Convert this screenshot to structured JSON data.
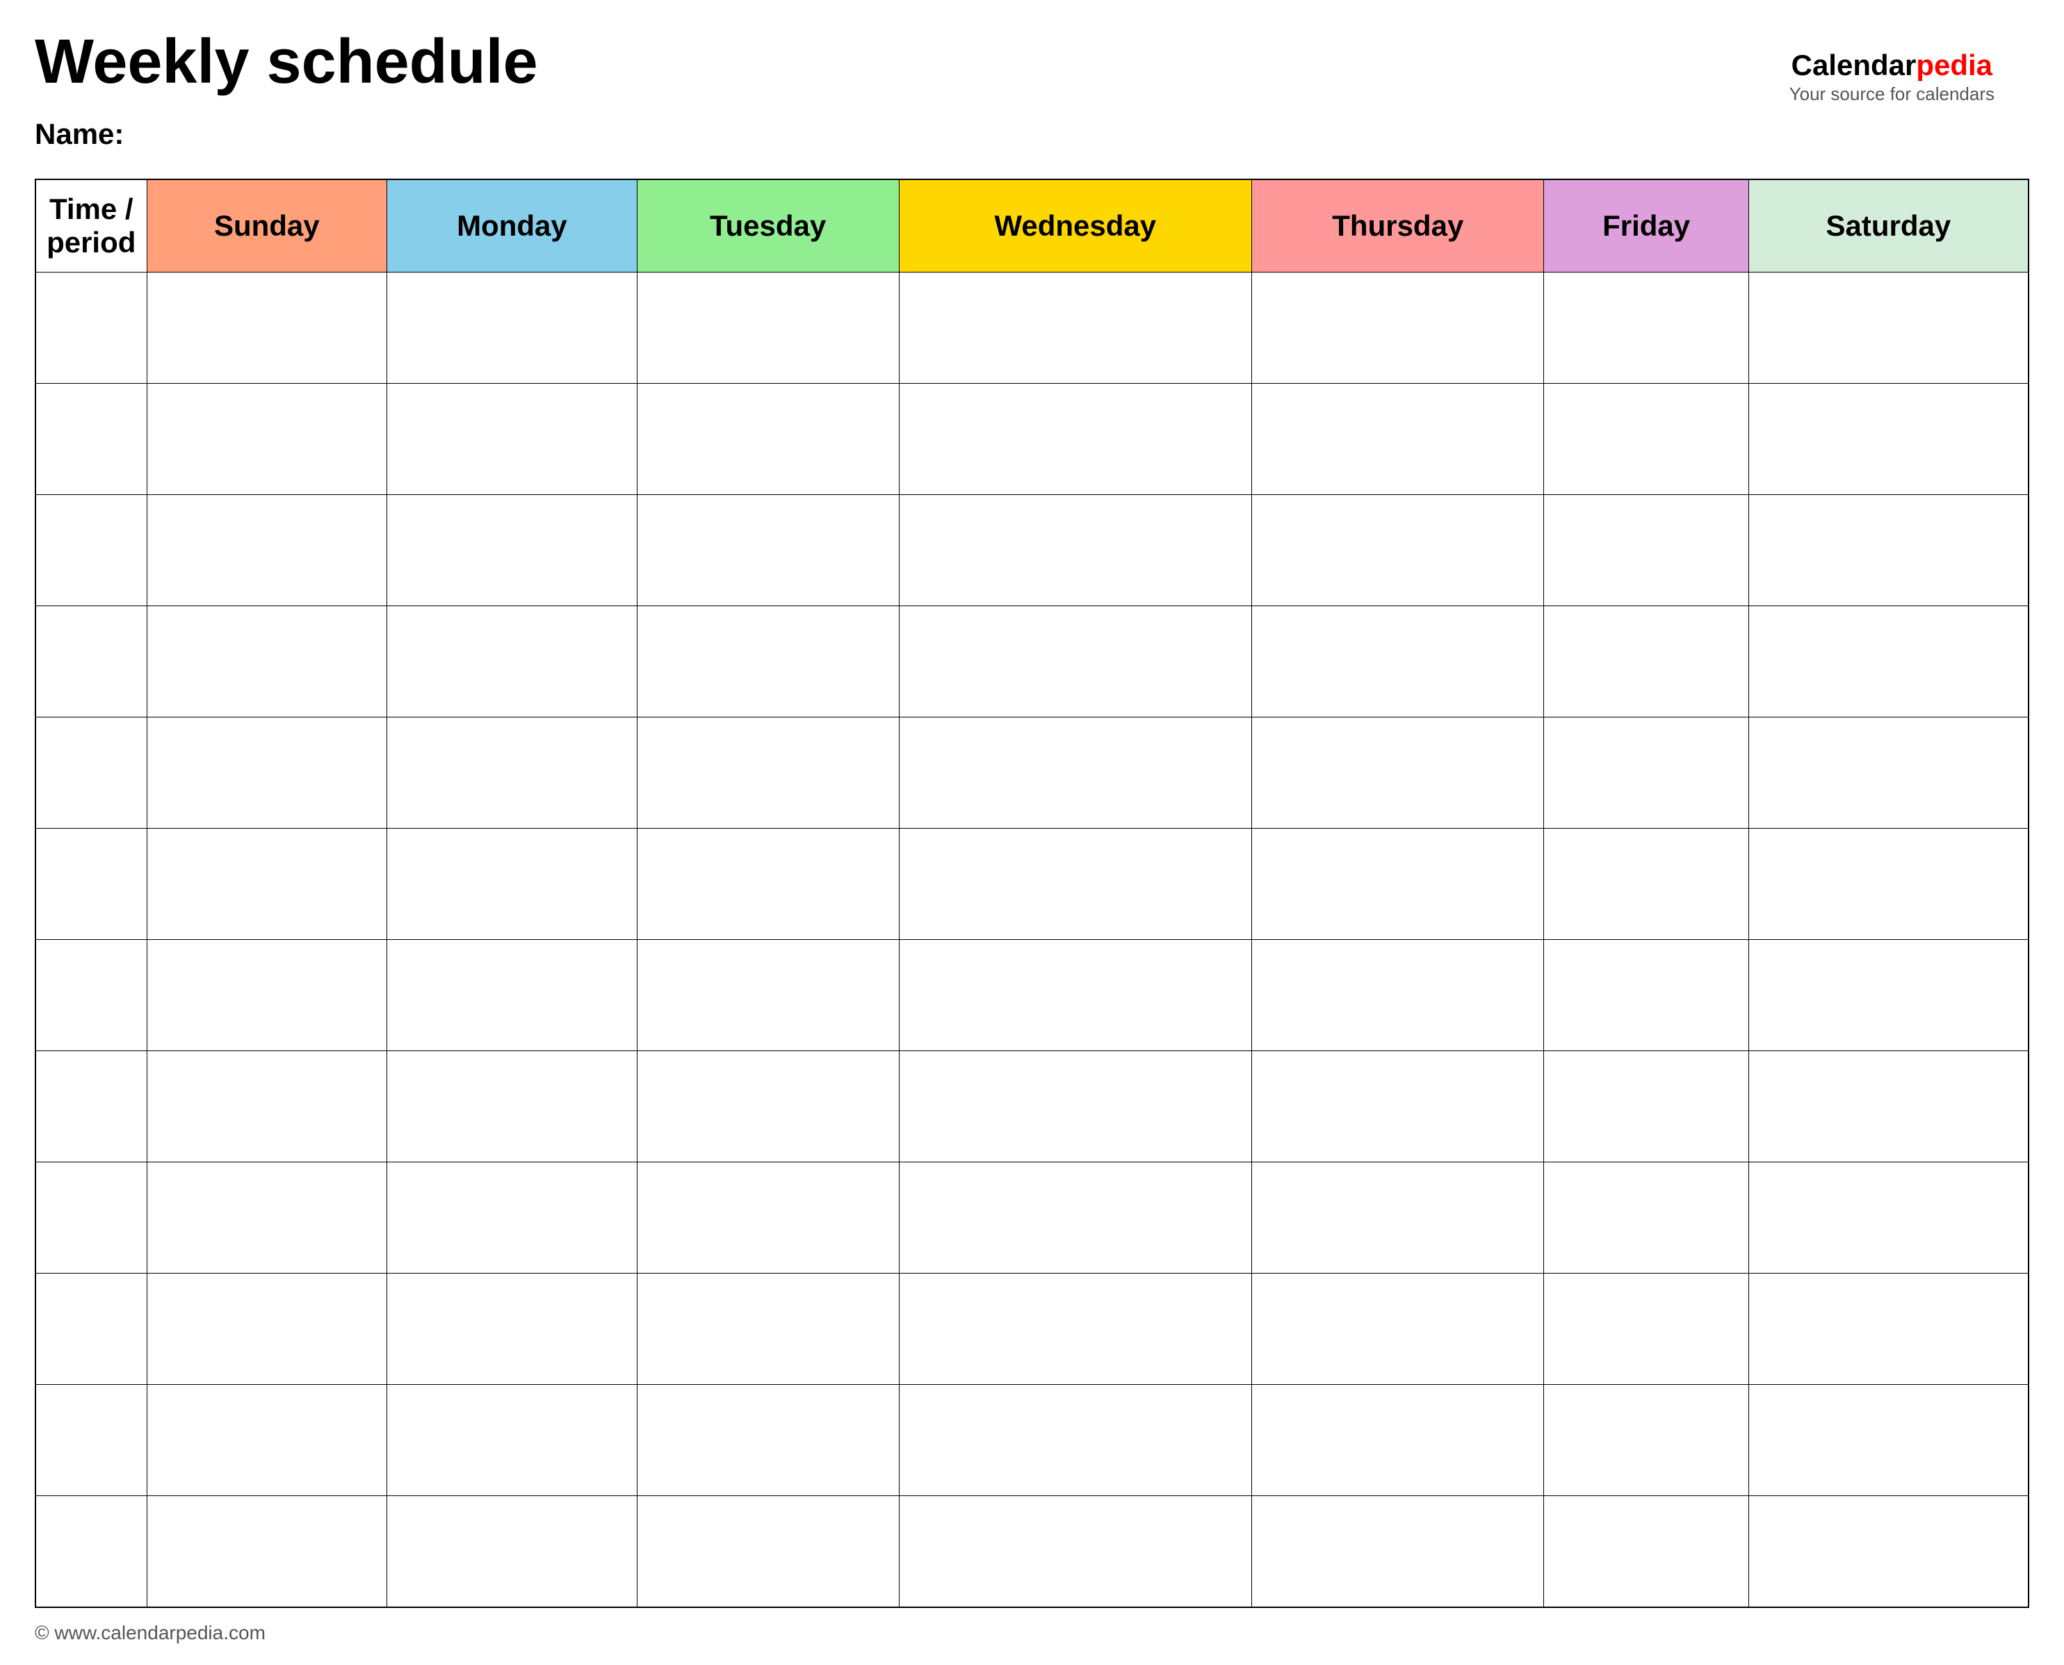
{
  "page": {
    "title": "Weekly schedule",
    "name_label": "Name:",
    "footer_text": "© www.calendarpedia.com"
  },
  "brand": {
    "calendar": "Calendar",
    "pedia": "pedia",
    "tagline": "Your source for calendars"
  },
  "table": {
    "headers": [
      {
        "id": "time",
        "label": "Time / period",
        "color": "#ffffff"
      },
      {
        "id": "sunday",
        "label": "Sunday",
        "color": "#ffa07a"
      },
      {
        "id": "monday",
        "label": "Monday",
        "color": "#87ceeb"
      },
      {
        "id": "tuesday",
        "label": "Tuesday",
        "color": "#90ee90"
      },
      {
        "id": "wednesday",
        "label": "Wednesday",
        "color": "#ffd700"
      },
      {
        "id": "thursday",
        "label": "Thursday",
        "color": "#ff9999"
      },
      {
        "id": "friday",
        "label": "Friday",
        "color": "#dda0dd"
      },
      {
        "id": "saturday",
        "label": "Saturday",
        "color": "#d4edda"
      }
    ],
    "row_count": 12
  }
}
